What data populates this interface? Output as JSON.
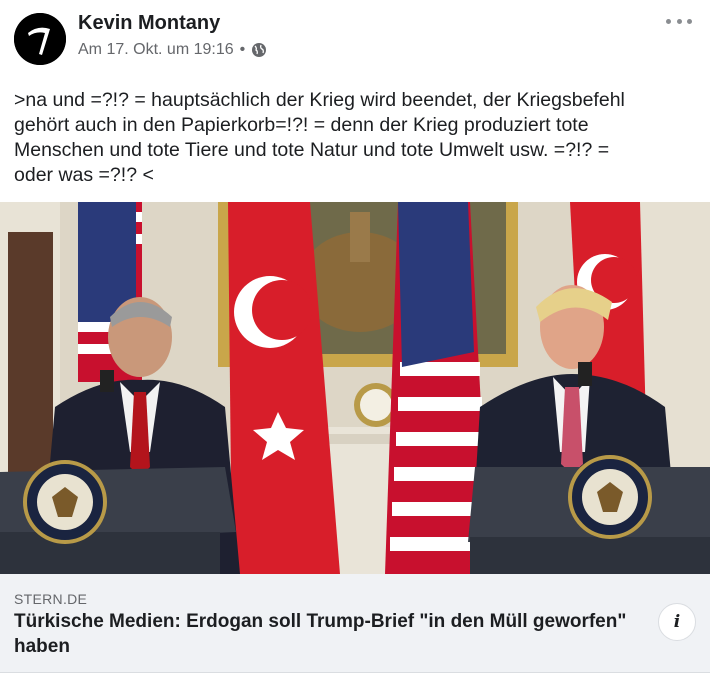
{
  "post": {
    "author": "Kevin Montany",
    "timestamp": "Am 17. Okt. um 19:16",
    "separator": "•",
    "privacy_icon": "globe-icon",
    "more_icon": "more-options-icon",
    "text": ">na und =?!? = hauptsächlich der Krieg wird beendet, der Kriegsbefehl\ngehört auch in den Papierkorb=!?! = denn der Krieg produziert tote\nMenschen und tote Tiere und tote Natur und tote Umwelt usw. =?!? =\noder was =?!? <"
  },
  "link_preview": {
    "source": "STERN.DE",
    "title": "Türkische Medien: Erdogan soll Trump-Brief \"in den Müll geworfen\" haben",
    "info_icon": "info-icon",
    "info_glyph": "i"
  },
  "colors": {
    "text": "#1c1e21",
    "secondary": "#65676b",
    "link_bg": "#f0f2f5",
    "turkish_flag": "#d81e2a",
    "us_blue": "#2a3a7a"
  }
}
